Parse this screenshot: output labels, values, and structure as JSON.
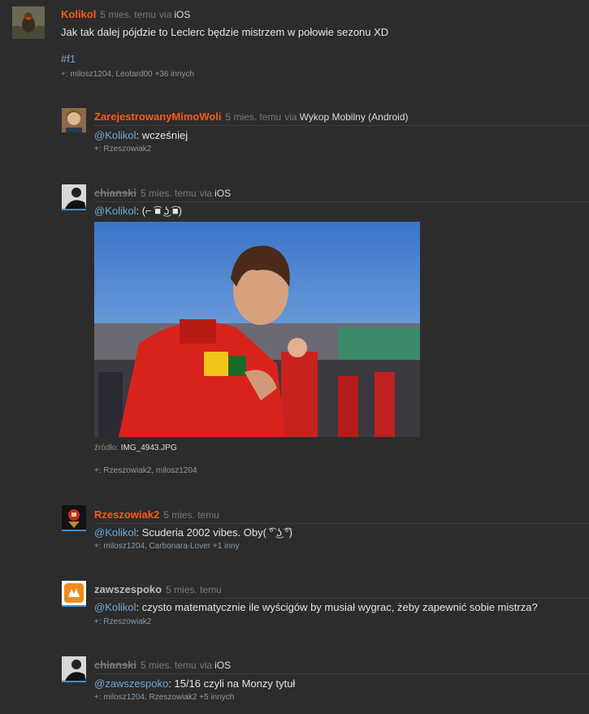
{
  "entries": [
    {
      "author": "Kolikol",
      "time": "5 mies. temu",
      "via": "via",
      "client": "iOS",
      "text": "Jak tak dalej pójdzie to Leclerc będzie mistrzem w połowie sezonu XD",
      "tag": "#f1",
      "plus_prefix": "+:",
      "plus_names": "milosz1204, Leotard00",
      "plus_more": "+36 innych"
    },
    {
      "author": "ZarejestrowanyMimoWoli",
      "time": "5 mies. temu",
      "via": "via",
      "client": "Wykop Mobilny (Android)",
      "mention": "@Kolikol",
      "text": ": wcześniej",
      "plus_prefix": "+:",
      "plus_names": "Rzeszowiak2"
    },
    {
      "author": "chianski",
      "time": "5 mies. temu",
      "via": "via",
      "client": "iOS",
      "mention": "@Kolikol",
      "text": ": (⌐ ͡■ ͜ʖ ͡■)",
      "source_label": "źródło:",
      "source_file": "IMG_4943.JPG",
      "plus_prefix": "+:",
      "plus_names": "Rzeszowiak2, milosz1204"
    },
    {
      "author": "Rzeszowiak2",
      "time": "5 mies. temu",
      "mention": "@Kolikol",
      "text": ": Scuderia 2002 vibes. Oby( ͡° ͜ʖ ͡°)",
      "plus_prefix": "+:",
      "plus_names": "milosz1204, Carbonara-Lover",
      "plus_more": "+1 inny"
    },
    {
      "author": "zawszespoko",
      "time": "5 mies. temu",
      "mention": "@Kolikol",
      "text": ": czysto matematycznie ile wyścigów by musiał wygrac, żeby zapewnić sobie mistrza?",
      "plus_prefix": "+:",
      "plus_names": "Rzeszowiak2"
    },
    {
      "author": "chianski",
      "time": "5 mies. temu",
      "via": "via",
      "client": "iOS",
      "mention": "@zawszespoko",
      "text": ": 15/16 czyli na Monzy tytuł",
      "plus_prefix": "+:",
      "plus_names": "milosz1204, Rzeszowiak2",
      "plus_more": "+5 innych"
    }
  ]
}
